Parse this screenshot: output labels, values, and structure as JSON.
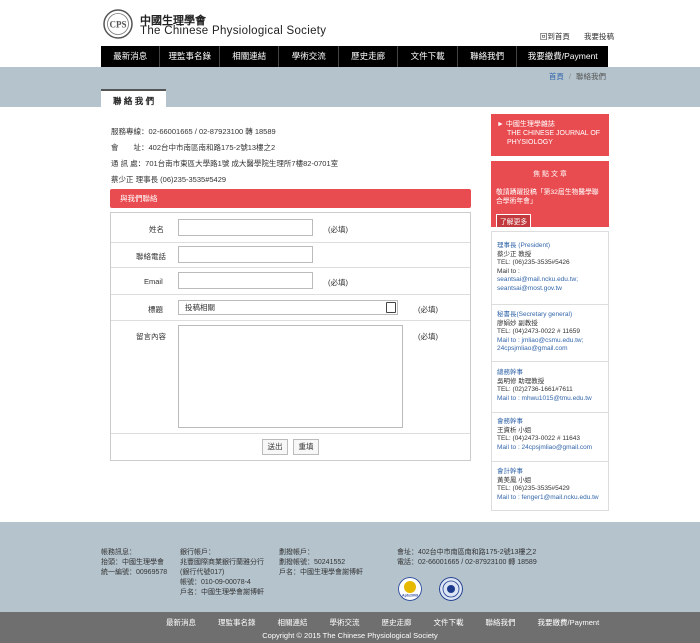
{
  "brand": {
    "name_zh": "中國生理學會",
    "name_en": "The Chinese Physiological Society",
    "logo_text": "CPS"
  },
  "top_links": [
    "回到首頁",
    "我要投稿"
  ],
  "nav": [
    "最新消息",
    "理監事名錄",
    "相關連結",
    "學術交流",
    "歷史走廊",
    "文件下載",
    "聯絡我們",
    "我要繳費/Payment"
  ],
  "breadcrumb": {
    "home": "首頁",
    "current": "聯絡我們"
  },
  "page_title": "聯 絡 我 們",
  "info": {
    "line1": "服務專線：02-66001665 / 02-87923100 轉 18589",
    "line2": "會　　址：402台中市南區南和路175-2號13樓之2",
    "line3": "通 訊 處：701台南市東區大學路1號 成大醫學院生理所7樓82-0701室",
    "line4": "蔡少正 理事長 (06)235-3535#5429"
  },
  "contact_bar": "與我們聯絡",
  "form": {
    "name_label": "姓名",
    "phone_label": "聯絡電話",
    "email_label": "Email",
    "subject_label": "標題",
    "message_label": "留言內容",
    "required": "(必填)",
    "subject_value": "投稿相關",
    "submit": "送出",
    "reset": "重填"
  },
  "sidebar": {
    "journal_line1": "► 中國生理學雜誌",
    "journal_line2": "THE CHINESE JOURNAL OF",
    "journal_line3": "PHYSIOLOGY",
    "focus_title": "焦 點 文 章",
    "focus_line1": "敬請踴躍投稿「第32屆生物醫學聯",
    "focus_line2": "合學術年會」",
    "focus_more": "了解更多",
    "people": [
      {
        "role": "理事長 (President)",
        "name": "蔡少正 教授",
        "tel": "TEL: (06)235-3535#5426",
        "mailto": "Mail to :",
        "mail1": "seantsai@mail.ncku.edu.tw;",
        "mail2": "seantsai@most.gov.tw"
      },
      {
        "role": "秘書長(Secretary general)",
        "name": "廖娟妙 副教授",
        "tel": "TEL: (04)2473-0022 # 11659",
        "mailto": "Mail to : jmliao@csmu.edu.tw;",
        "mail1": "24cpsjmliao@gmail.com",
        "mail2": ""
      },
      {
        "role": "總務幹事",
        "name": "吳明修 助理教授",
        "tel": "TEL: (02)2736-1661#7611",
        "mailto": "Mail to : mhwu1015@tmu.edu.tw",
        "mail1": "",
        "mail2": ""
      },
      {
        "role": "會務幹事",
        "name": "王資析 小姐",
        "tel": "TEL: (04)2473-0022 # 11643",
        "mailto": "Mail to : 24cpsjmliao@gmail.com",
        "mail1": "",
        "mail2": ""
      },
      {
        "role": "會計幹事",
        "name": "黃美鳳 小姐",
        "tel": "TEL: (06)235-3535#5429",
        "mailto": "Mail to : fenger1@mail.ncku.edu.tw",
        "mail1": "",
        "mail2": ""
      }
    ]
  },
  "footer": {
    "col1": [
      "帳務訊息：",
      "抬頭：中國生理學會",
      "統一編號：00969578"
    ],
    "col2": [
      "銀行帳戶：",
      "兆豐國際商業銀行蘭雅分行",
      "(銀行代號017)",
      "帳號：010-09-00078-4",
      "戶名：中國生理學會謝博軒"
    ],
    "col3": [
      "劃撥帳戶：",
      "劃撥帳號：50241552",
      "戶名：中國生理學會謝博軒"
    ],
    "col4": [
      "會址：402台中市南區南和路175-2號13樓之2",
      "電話：02-66001665 / 02-87923100 轉 18589"
    ],
    "badge_text": "Apts2009",
    "links": [
      "最新消息",
      "理監事名錄",
      "相關連結",
      "學術交流",
      "歷史走廊",
      "文件下載",
      "聯絡我們",
      "我要繳費/Payment"
    ],
    "copyright": "Copyright © 2015 The Chinese Physiological Society"
  },
  "colors": {
    "accent": "#e84c50",
    "band": "#b4c3cc",
    "nav": "#000000",
    "link": "#3366aa"
  }
}
